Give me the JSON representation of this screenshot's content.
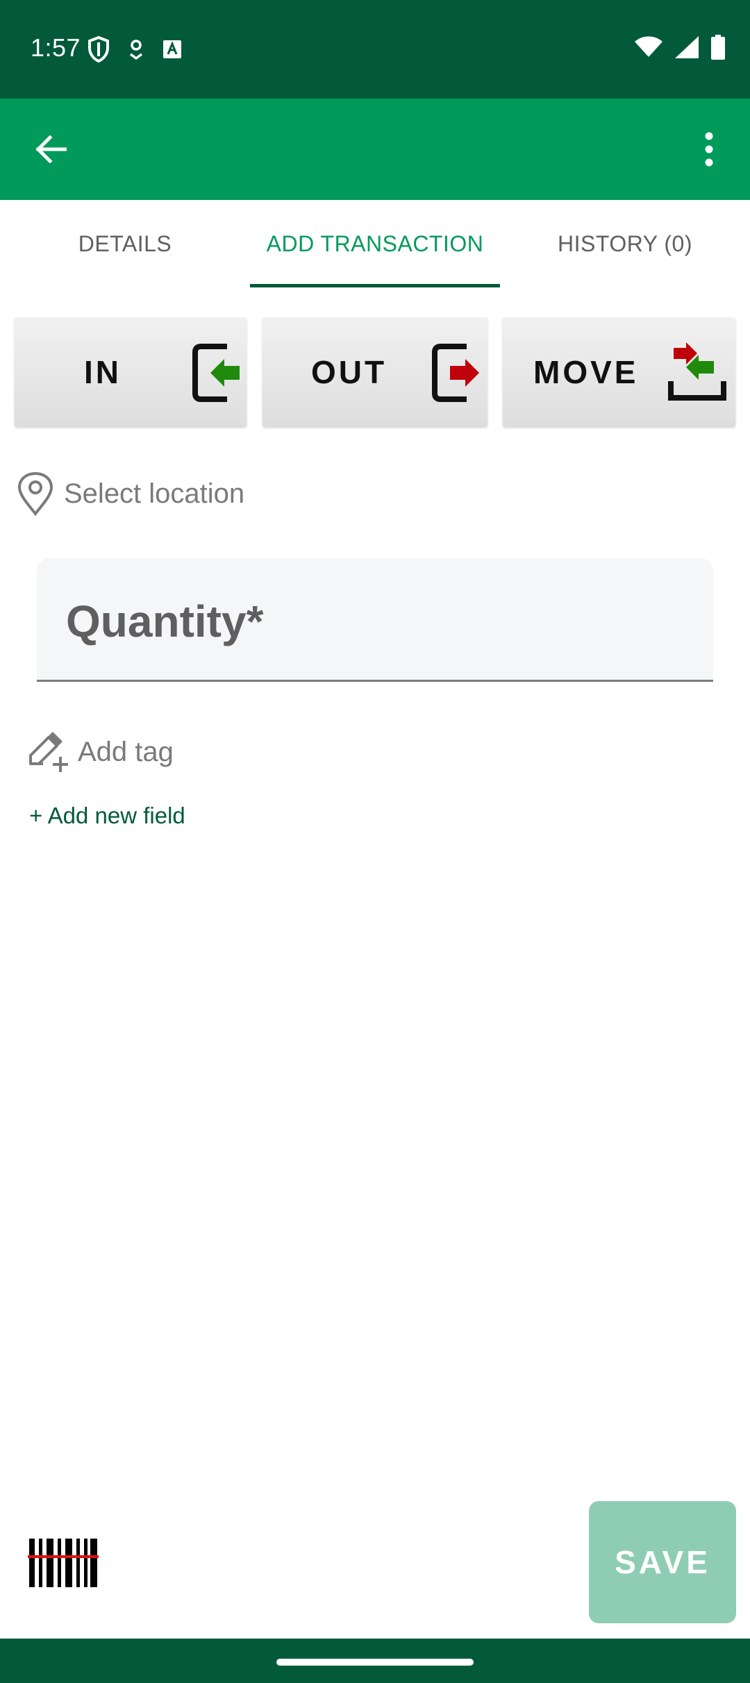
{
  "status_bar": {
    "time": "1:57",
    "icons_left": [
      "shield-icon",
      "location-pin-small-icon",
      "a-box-icon"
    ],
    "icons_right": [
      "wifi-icon",
      "signal-icon",
      "battery-icon"
    ]
  },
  "app_bar": {
    "back_icon": "arrow-back-icon",
    "more_icon": "more-vertical-icon"
  },
  "tabs": [
    {
      "label": "DETAILS",
      "active": false
    },
    {
      "label": "ADD TRANSACTION",
      "active": true
    },
    {
      "label": "HISTORY (0)",
      "active": false
    }
  ],
  "actions": {
    "in_label": "IN",
    "out_label": "OUT",
    "move_label": "MOVE"
  },
  "location": {
    "placeholder": "Select location"
  },
  "quantity": {
    "placeholder": "Quantity*"
  },
  "tag": {
    "label": "Add tag"
  },
  "add_field": {
    "label": "+ Add new field"
  },
  "save_label": "SAVE",
  "colors": {
    "status_bar": "#025a3a",
    "app_bar": "#029a5b",
    "accent": "#029a5b",
    "dark_accent": "#025a3a",
    "in_arrow": "#1f8a0b",
    "out_arrow": "#c0000a",
    "save_disabled": "#8ecdb4"
  }
}
